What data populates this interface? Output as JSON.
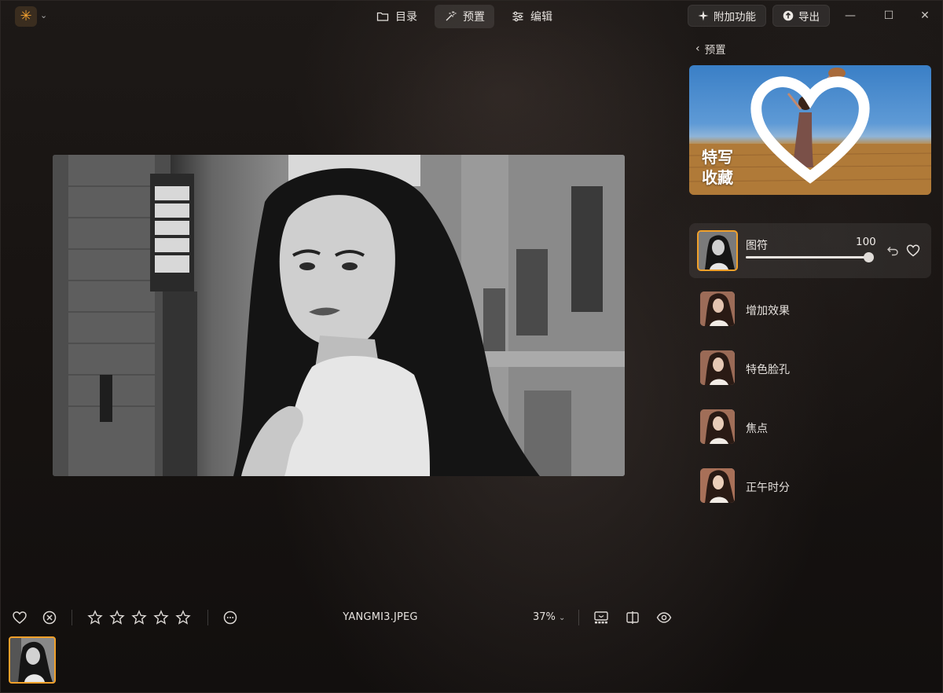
{
  "titlebar": {
    "nav": [
      {
        "label": "目录",
        "icon": "folder-icon"
      },
      {
        "label": "预置",
        "icon": "magic-wand-icon",
        "active": true
      },
      {
        "label": "编辑",
        "icon": "sliders-icon"
      }
    ],
    "addons_label": "附加功能",
    "export_label": "导出"
  },
  "panel": {
    "back_label": "预置",
    "banner": {
      "title": "特写",
      "subtitle": "收藏"
    },
    "active_preset": {
      "name": "图符",
      "value": "100",
      "level": 1.0
    },
    "presets": [
      {
        "name": "增加效果"
      },
      {
        "name": "特色脸孔"
      },
      {
        "name": "焦点"
      },
      {
        "name": "正午时分"
      }
    ]
  },
  "toolbar": {
    "filename": "YANGMI3.JPEG",
    "zoom": "37%",
    "rating_stars": 5,
    "rating_value": 0
  },
  "colors": {
    "accent": "#f0a02a",
    "background": "#141110"
  }
}
